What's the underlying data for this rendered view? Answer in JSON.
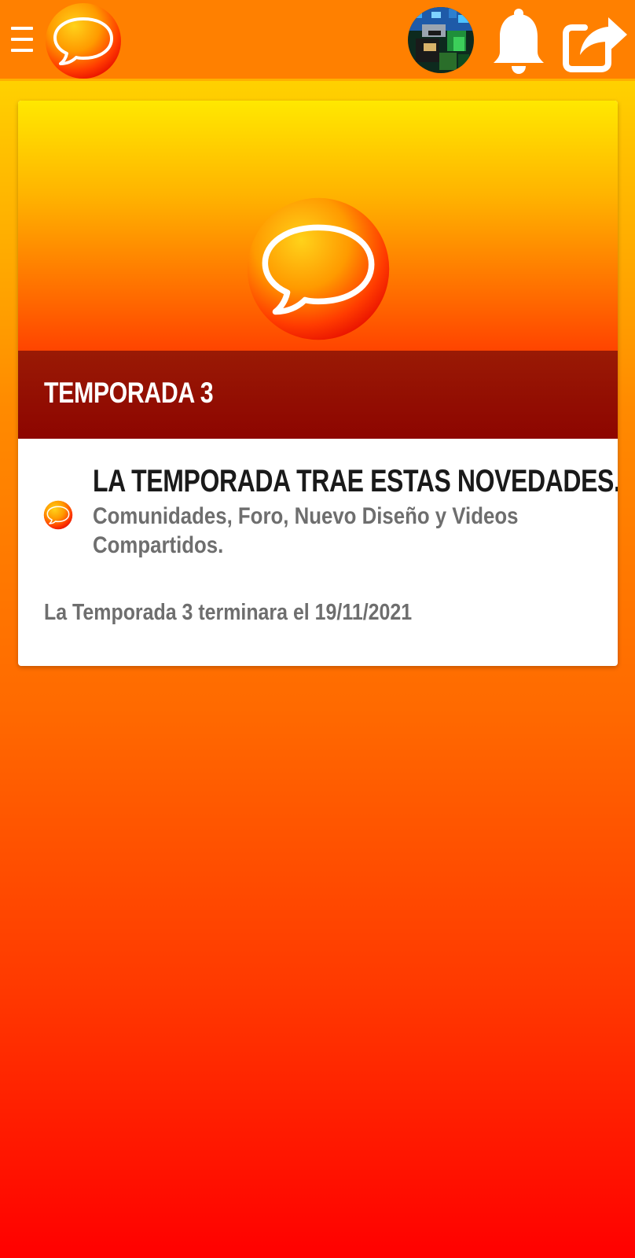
{
  "topbar": {
    "menu_icon": "hamburger-menu-icon",
    "logo_icon": "chat-bubble-logo-icon",
    "avatar_icon": "user-avatar",
    "notifications_icon": "bell-icon",
    "share_icon": "share-icon"
  },
  "card": {
    "hero_icon": "chat-bubble-logo-icon",
    "title": "TEMPORADA 3",
    "news": {
      "icon": "chat-bubble-logo-icon",
      "heading": "LA TEMPORADA TRAE ESTAS NOVEDADES.",
      "body": "Comunidades, Foro, Nuevo Diseño y Videos Compartidos."
    },
    "footer": "La Temporada 3 terminara el 19/11/2021"
  },
  "colors": {
    "topbar": "#ff8000",
    "title_bar": "#8d0500",
    "card_background": "#ffffff",
    "heading_text": "#1a1a1a",
    "body_text": "#6e6e6e"
  }
}
